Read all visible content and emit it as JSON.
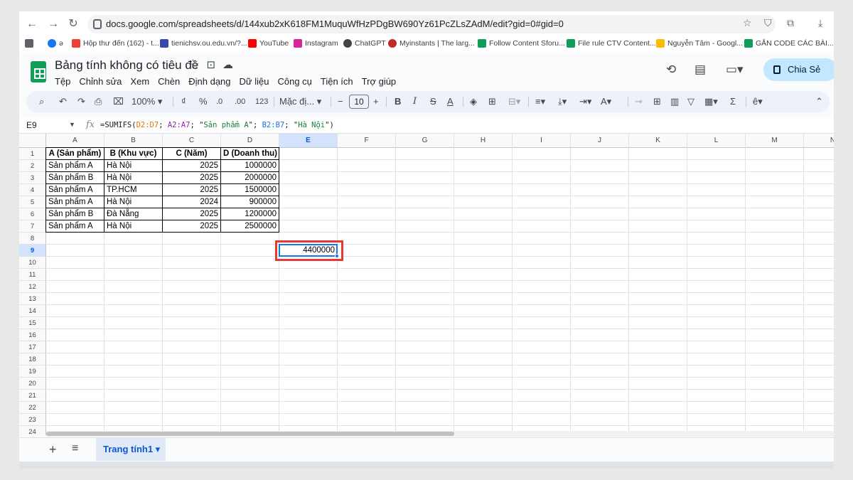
{
  "browser": {
    "url": "docs.google.com/spreadsheets/d/144xub2xK618FM1MuquWfHzPDgBW690Yz61PcZLsZAdM/edit?gid=0#gid=0",
    "bookmarks": [
      "Hộp thư đến (162) - t...",
      "tienichsv.ou.edu.vn/?...",
      "YouTube",
      "Instagram",
      "ChatGPT",
      "Myinstants | The larg...",
      "Follow Content Sforu...",
      "File rule CTV Content...",
      "Nguyễn Tâm - Googl...",
      "GẮN CODE CÁC BÀI..."
    ]
  },
  "doc": {
    "title": "Bảng tính không có tiêu đề",
    "share_label": "Chia Sẻ",
    "menu": [
      "Tệp",
      "Chỉnh sửa",
      "Xem",
      "Chèn",
      "Định dạng",
      "Dữ liệu",
      "Công cụ",
      "Tiện ích",
      "Trợ giúp"
    ]
  },
  "toolbar": {
    "zoom": "100%",
    "currency": "₫",
    "percent": "%",
    "dec_less": ".0",
    "dec_more": ".00",
    "number_format": "123",
    "font": "Mặc đị...",
    "font_size": "10"
  },
  "formula_bar": {
    "name_box": "E9",
    "fx": "fx",
    "formula_parts": [
      "=SUMIFS(",
      "D2:D7",
      "; ",
      "A2:A7",
      "; \"",
      "Sản phẩm A",
      "\"; ",
      "B2:B7",
      "; \"",
      "Hà Nội",
      "\")"
    ]
  },
  "grid": {
    "columns": [
      "A",
      "B",
      "C",
      "D",
      "E",
      "F",
      "G",
      "H",
      "I",
      "J",
      "K",
      "L",
      "M",
      "N"
    ],
    "rows": [
      "1",
      "2",
      "3",
      "4",
      "5",
      "6",
      "7",
      "8",
      "9",
      "10",
      "11",
      "12",
      "13",
      "14",
      "15",
      "16",
      "17",
      "18",
      "19",
      "20",
      "21",
      "22",
      "23",
      "24"
    ],
    "table": [
      [
        "A (Sản phẩm)",
        "B (Khu vực)",
        "C (Năm)",
        "D (Doanh thu)"
      ],
      [
        "Sản phẩm A",
        "Hà Nội",
        "2025",
        "1000000"
      ],
      [
        "Sản phẩm B",
        "Hà Nội",
        "2025",
        "2000000"
      ],
      [
        "Sản phẩm A",
        "TP.HCM",
        "2025",
        "1500000"
      ],
      [
        "Sản phẩm A",
        "Hà Nội",
        "2024",
        "900000"
      ],
      [
        "Sản phẩm B",
        "Đà Nẵng",
        "2025",
        "1200000"
      ],
      [
        "Sản phẩm A",
        "Hà Nội",
        "2025",
        "2500000"
      ]
    ],
    "result_value": "4400000",
    "selected_cell": "E9"
  },
  "sheets": {
    "active_tab": "Trang tính1"
  }
}
